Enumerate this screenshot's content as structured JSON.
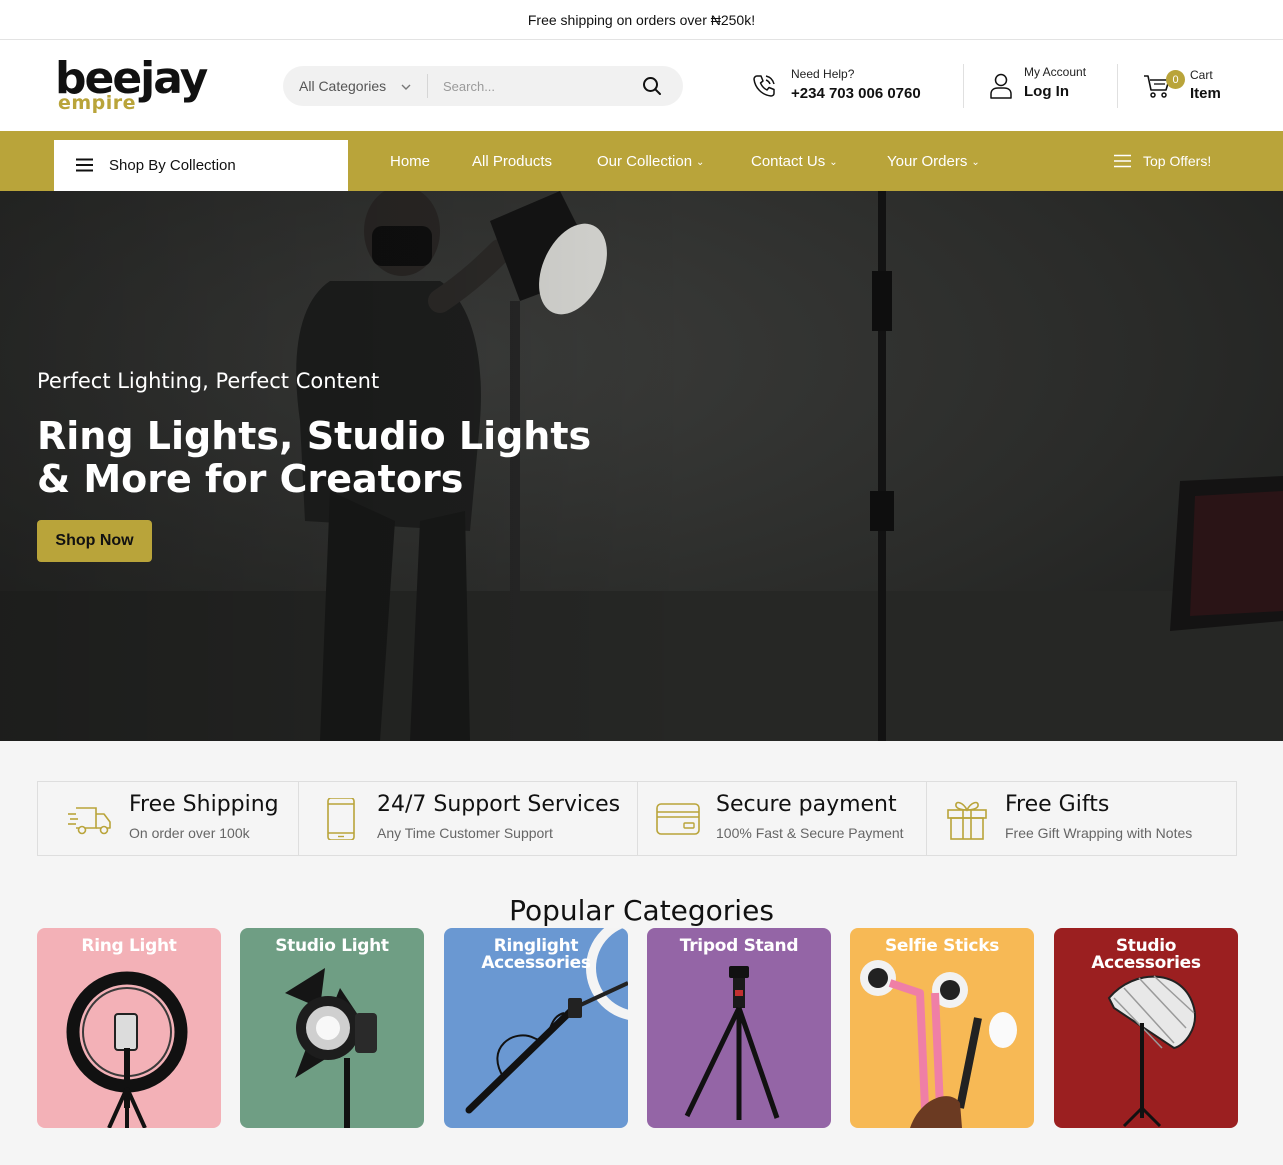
{
  "announcement": "Free shipping on orders over ₦250k!",
  "brand": {
    "name_top": "beejay",
    "name_bottom": "empire"
  },
  "search": {
    "category": "All Categories",
    "placeholder": "Search..."
  },
  "help": {
    "label": "Need Help?",
    "phone": "+234 703 006 0760"
  },
  "account": {
    "label": "My Account",
    "action": "Log In"
  },
  "cart": {
    "count": "0",
    "label": "Cart",
    "sub": "Item"
  },
  "nav": {
    "collection_button": "Shop By Collection",
    "items": [
      {
        "label": "Home",
        "dropdown": false
      },
      {
        "label": "All Products",
        "dropdown": false
      },
      {
        "label": "Our Collection",
        "dropdown": true
      },
      {
        "label": "Contact Us",
        "dropdown": true
      },
      {
        "label": "Your Orders",
        "dropdown": true
      }
    ],
    "top_offers": "Top Offers!"
  },
  "hero": {
    "kicker": "Perfect Lighting, Perfect Content",
    "headline": "Ring Lights, Studio Lights & More for Creators",
    "cta": "Shop Now"
  },
  "features": [
    {
      "icon": "delivery-truck-icon",
      "title": "Free Shipping",
      "subtitle": "On order over 100k"
    },
    {
      "icon": "mobile-phone-icon",
      "title": "24/7 Support Services",
      "subtitle": "Any Time Customer Support"
    },
    {
      "icon": "credit-card-icon",
      "title": "Secure payment",
      "subtitle": "100% Fast & Secure Payment"
    },
    {
      "icon": "gift-box-icon",
      "title": "Free Gifts",
      "subtitle": "Free Gift Wrapping with Notes"
    }
  ],
  "categories_title": "Popular Categories",
  "categories": [
    {
      "line1": "Ring Light",
      "line2": "",
      "color": "#f3b1b7"
    },
    {
      "line1": "Studio Light",
      "line2": "",
      "color": "#6f9e84"
    },
    {
      "line1": "Ringlight",
      "line2": "Accessories",
      "color": "#6a98d2"
    },
    {
      "line1": "Tripod Stand",
      "line2": "",
      "color": "#9465a6"
    },
    {
      "line1": "Selfie Sticks",
      "line2": "",
      "color": "#f7b955"
    },
    {
      "line1": "Studio",
      "line2": "Accessories",
      "color": "#9b1f20"
    }
  ],
  "colors": {
    "accent": "#b9a43a",
    "text": "#111111"
  }
}
